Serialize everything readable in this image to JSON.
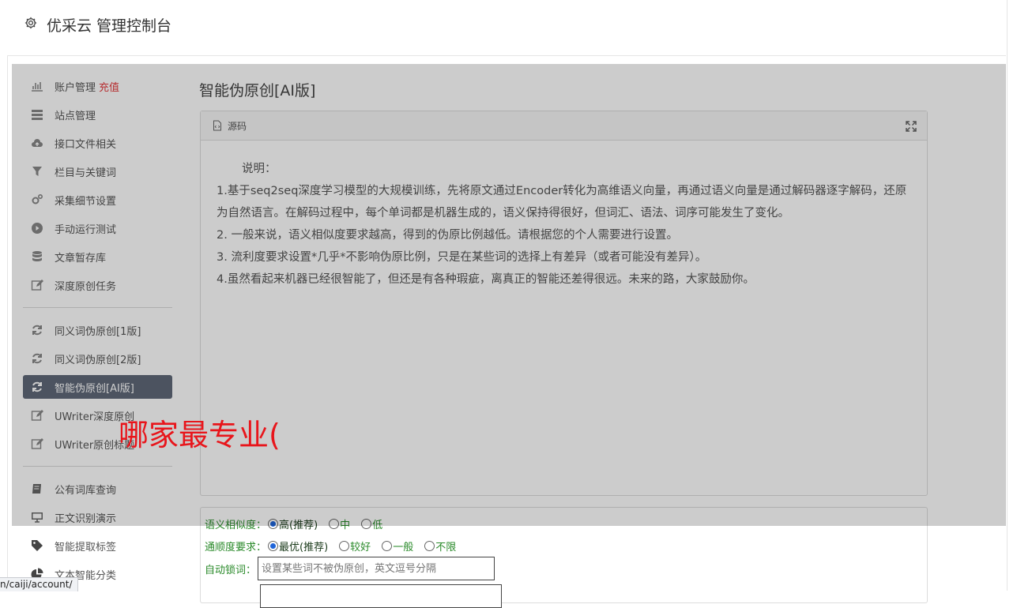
{
  "app": {
    "title": "优采云 管理控制台"
  },
  "sidebar": {
    "items": [
      {
        "label": "账户管理",
        "badge": "充值",
        "icon": "bar-chart-icon"
      },
      {
        "label": "站点管理",
        "icon": "server-icon"
      },
      {
        "label": "接口文件相关",
        "icon": "cloud-upload-icon"
      },
      {
        "label": "栏目与关键词",
        "icon": "filter-icon"
      },
      {
        "label": "采集细节设置",
        "icon": "gears-icon"
      },
      {
        "label": "手动运行测试",
        "icon": "play-circle-icon"
      },
      {
        "label": "文章暂存库",
        "icon": "database-icon"
      },
      {
        "label": "深度原创任务",
        "icon": "edit-icon"
      },
      {
        "label": "同义词伪原创[1版]",
        "icon": "refresh-icon"
      },
      {
        "label": "同义词伪原创[2版]",
        "icon": "refresh-icon"
      },
      {
        "label": "智能伪原创[AI版]",
        "icon": "refresh-icon",
        "active": true
      },
      {
        "label": "UWriter深度原创",
        "icon": "edit-icon"
      },
      {
        "label": "UWriter原创标题",
        "icon": "edit-icon"
      },
      {
        "label": "公有词库查询",
        "icon": "book-icon"
      },
      {
        "label": "正文识别演示",
        "icon": "monitor-icon"
      },
      {
        "label": "智能提取标签",
        "icon": "tag-icon"
      },
      {
        "label": "文本智能分类",
        "icon": "pie-chart-icon"
      }
    ]
  },
  "main": {
    "title": "智能伪原创[AI版]",
    "panel": {
      "header": "源码",
      "intro": "说明：",
      "lines": [
        "1.基于seq2seq深度学习模型的大规模训练，先将原文通过Encoder转化为高维语义向量，再通过语义向量是通过解码器逐字解码，还原为自然语言。在解码过程中，每个单词都是机器生成的，语义保持得很好，但词汇、语法、词序可能发生了变化。",
        "2. 一般来说，语义相似度要求越高，得到的伪原比例越低。请根据您的个人需要进行设置。",
        "3. 流利度要求设置*几乎*不影响伪原比例，只是在某些词的选择上有差异（或者可能没有差异）。",
        "4.虽然看起来机器已经很智能了，但还是有各种瑕疵，离真正的智能还差得很远。未来的路，大家鼓励你。"
      ]
    },
    "form": {
      "similarity": {
        "label": "语义相似度：",
        "options": [
          "高(推荐)",
          "中",
          "低"
        ],
        "selected": 0
      },
      "fluency": {
        "label": "通顺度要求：",
        "options": [
          "最优(推荐)",
          "较好",
          "一般",
          "不限"
        ],
        "selected": 0
      },
      "lock": {
        "label": "自动锁词：",
        "placeholder": "设置某些词不被伪原创，英文逗号分隔"
      }
    }
  },
  "overlay_text": "哪家最专业(",
  "status_bar": {
    "url": "n/caiji/account/"
  },
  "colors": {
    "active_bg": "#5f6878",
    "recharge": "#e4393c",
    "overlay_text": "#e8151b",
    "form_label": "#2a8a2a"
  }
}
